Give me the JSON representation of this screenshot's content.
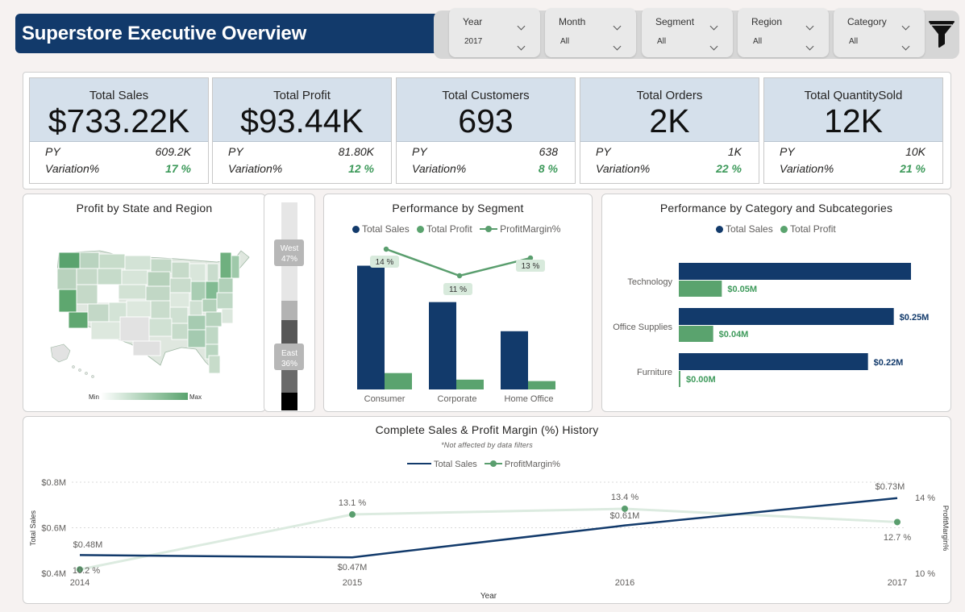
{
  "header": {
    "title": "Superstore Executive Overview"
  },
  "filters": [
    {
      "label": "Year",
      "value": "2017"
    },
    {
      "label": "Month",
      "value": "All"
    },
    {
      "label": "Segment",
      "value": "All"
    },
    {
      "label": "Region",
      "value": "All"
    },
    {
      "label": "Category",
      "value": "All"
    }
  ],
  "filter_icon": "funnel-icon",
  "kpis": [
    {
      "title": "Total Sales",
      "value": "$733.22K",
      "py_label": "PY",
      "py": "609.2K",
      "var_label": "Variation%",
      "variation": "17 %"
    },
    {
      "title": "Total Profit",
      "value": "$93.44K",
      "py_label": "PY",
      "py": "81.80K",
      "var_label": "Variation%",
      "variation": "12 %"
    },
    {
      "title": "Total Customers",
      "value": "693",
      "py_label": "PY",
      "py": "638",
      "var_label": "Variation%",
      "variation": "8 %"
    },
    {
      "title": "Total Orders",
      "value": "2K",
      "py_label": "PY",
      "py": "1K",
      "var_label": "Variation%",
      "variation": "22 %"
    },
    {
      "title": "Total QuantitySold",
      "value": "12K",
      "py_label": "PY",
      "py": "10K",
      "var_label": "Variation%",
      "variation": "21 %"
    }
  ],
  "colors": {
    "navy": "#123a6b",
    "green": "#5aa36e",
    "line_green": "#5a9e6e",
    "light_green": "#d8eadc"
  },
  "map": {
    "title": "Profit by State and Region",
    "legend_min": "Min",
    "legend_max": "Max",
    "region_bar": [
      {
        "label": "West",
        "pct": "47%"
      },
      {
        "label": "East",
        "pct": "36%"
      }
    ]
  },
  "segment_chart": {
    "title": "Performance by Segment",
    "legend": [
      "Total Sales",
      "Total Profit",
      "ProfitMargin%"
    ],
    "chart_data": {
      "type": "bar",
      "categories": [
        "Consumer",
        "Corporate",
        "Home Office"
      ],
      "series": [
        {
          "name": "Total Sales",
          "values": [
            0.34,
            0.24,
            0.16
          ]
        },
        {
          "name": "Total Profit",
          "values": [
            0.045,
            0.027,
            0.023
          ]
        },
        {
          "name": "ProfitMargin%",
          "values": [
            14,
            11,
            13
          ]
        }
      ],
      "margin_labels": [
        "14 %",
        "11 %",
        "13 %"
      ]
    }
  },
  "category_chart": {
    "title": "Performance by Category and Subcategories",
    "legend": [
      "Total Sales",
      "Total Profit"
    ],
    "chart_data": {
      "type": "bar",
      "categories": [
        "Technology",
        "Office Supplies",
        "Furniture"
      ],
      "series": [
        {
          "name": "Total Sales",
          "values": [
            0.27,
            0.25,
            0.22
          ],
          "labels": [
            "",
            "$0.25M",
            "$0.22M"
          ]
        },
        {
          "name": "Total Profit",
          "values": [
            0.05,
            0.04,
            0.0
          ],
          "labels": [
            "$0.05M",
            "$0.04M",
            "$0.00M"
          ]
        }
      ]
    }
  },
  "history_chart": {
    "title": "Complete Sales & Profit Margin (%) History",
    "subtitle": "*Not affected by data filters",
    "legend": [
      "Total Sales",
      "ProfitMargin%"
    ],
    "chart_data": {
      "type": "line",
      "x": [
        "2014",
        "2015",
        "2016",
        "2017"
      ],
      "series": [
        {
          "name": "Total Sales",
          "values": [
            0.48,
            0.47,
            0.61,
            0.73
          ],
          "labels": [
            "$0.48M",
            "$0.47M",
            "$0.61M",
            "$0.73M"
          ]
        },
        {
          "name": "ProfitMargin%",
          "values": [
            10.2,
            13.1,
            13.4,
            12.7
          ],
          "labels": [
            "10.2 %",
            "13.1 %",
            "13.4 %",
            "12.7 %"
          ]
        }
      ],
      "xlabel": "Year",
      "ylabel": "Total Sales",
      "y2label": "ProfitMargin%",
      "yticks": [
        "$0.4M",
        "$0.6M",
        "$0.8M"
      ],
      "ylim": [
        0.4,
        0.8
      ],
      "y2ticks": [
        "10 %",
        "14 %"
      ],
      "y2lim": [
        10,
        14.8
      ]
    }
  }
}
